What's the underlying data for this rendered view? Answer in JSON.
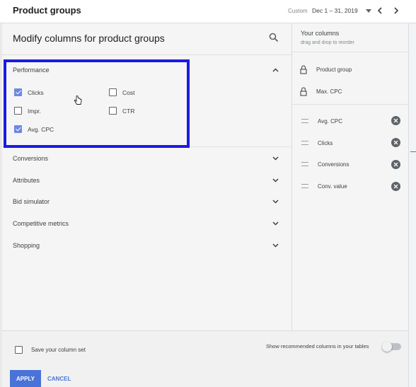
{
  "header": {
    "title": "Product groups",
    "date_range_label": "Custom",
    "date_range_value": "Dec 1 – 31, 2019"
  },
  "dialog": {
    "title": "Modify columns for product groups",
    "performance": {
      "title": "Performance",
      "checkboxes": [
        {
          "label": "Clicks",
          "checked": true
        },
        {
          "label": "Cost",
          "checked": false
        },
        {
          "label": "Impr.",
          "checked": false
        },
        {
          "label": "CTR",
          "checked": false
        },
        {
          "label": "Avg. CPC",
          "checked": true
        }
      ]
    },
    "sections": [
      "Conversions",
      "Attributes",
      "Bid simulator",
      "Competitive metrics",
      "Shopping"
    ]
  },
  "your_columns": {
    "title": "Your columns",
    "subtitle": "drag and drop to reorder",
    "fixed": [
      "Product group",
      "Max. CPC"
    ],
    "columns": [
      "Avg. CPC",
      "Clicks",
      "Conversions",
      "Conv. value"
    ]
  },
  "footer": {
    "save_label": "Save your column set",
    "save_checked": false,
    "recommended_label": "Show recommended columns in your tables",
    "recommended_on": false,
    "apply_label": "APPLY",
    "cancel_label": "CANCEL"
  },
  "colors": {
    "accent": "#4a73d9",
    "checkbox_checked": "#6b88e4",
    "highlight_box": "#1a1ae6"
  },
  "icons": [
    "search-icon",
    "chevron-up-icon",
    "chevron-down-icon",
    "lock-icon",
    "drag-handle-icon",
    "remove-icon",
    "dropdown-arrow-icon",
    "chevron-left-icon",
    "chevron-right-icon",
    "hand-cursor-icon"
  ]
}
